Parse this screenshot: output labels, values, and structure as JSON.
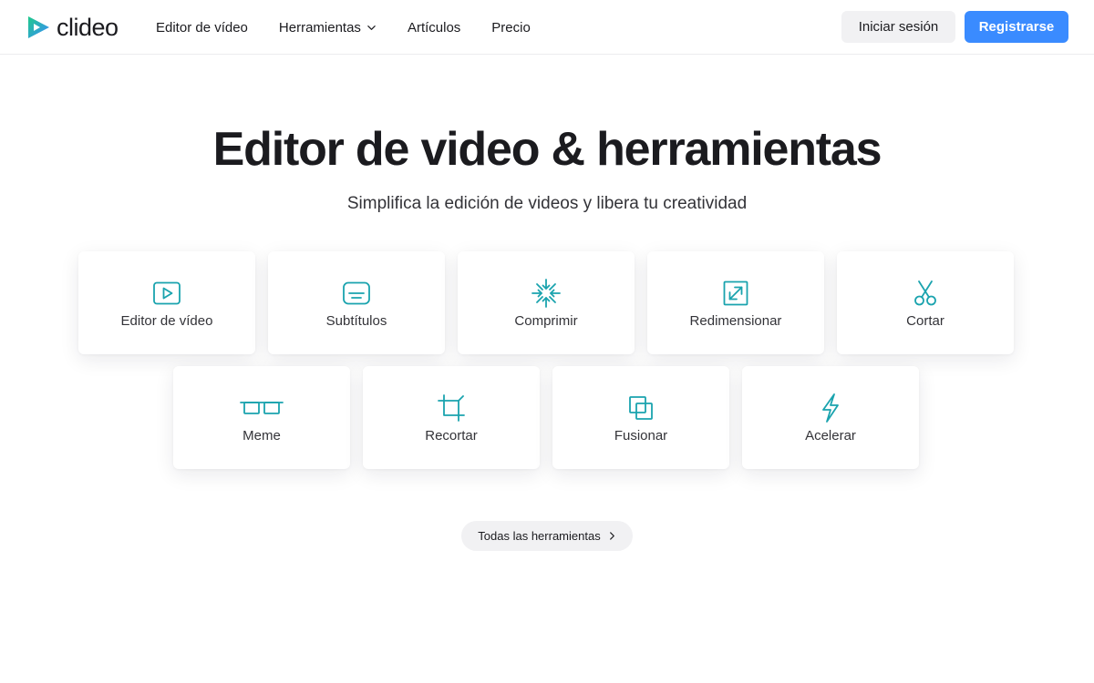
{
  "header": {
    "logo_text": "clideo",
    "logo_colors": [
      "#1fc98a",
      "#3a8bff"
    ],
    "nav": [
      {
        "label": "Editor de vídeo"
      },
      {
        "label": "Herramientas",
        "icon": "chevron-down-icon"
      },
      {
        "label": "Artículos"
      },
      {
        "label": "Precio"
      }
    ],
    "login_label": "Iniciar sesión",
    "signup_label": "Registrarse"
  },
  "hero": {
    "title": "Editor de video & herramientas",
    "subtitle": "Simplifica la edición de videos y libera tu creatividad"
  },
  "tools": {
    "icon_color": "#1aa3ae",
    "items": [
      {
        "label": "Editor de vídeo",
        "icon": "play-icon"
      },
      {
        "label": "Subtítulos",
        "icon": "subtitles-icon"
      },
      {
        "label": "Comprimir",
        "icon": "compress-icon"
      },
      {
        "label": "Redimensionar",
        "icon": "resize-icon"
      },
      {
        "label": "Cortar",
        "icon": "scissors-icon"
      },
      {
        "label": "Meme",
        "icon": "meme-icon"
      },
      {
        "label": "Recortar",
        "icon": "crop-icon"
      },
      {
        "label": "Fusionar",
        "icon": "merge-icon"
      },
      {
        "label": "Acelerar",
        "icon": "lightning-icon"
      }
    ],
    "all_tools_label": "Todas las herramientas",
    "all_tools_icon": "chevron-right-icon"
  },
  "colors": {
    "accent": "#3a8bff",
    "button_secondary": "#f1f1f3",
    "text": "#1b1b1f"
  }
}
